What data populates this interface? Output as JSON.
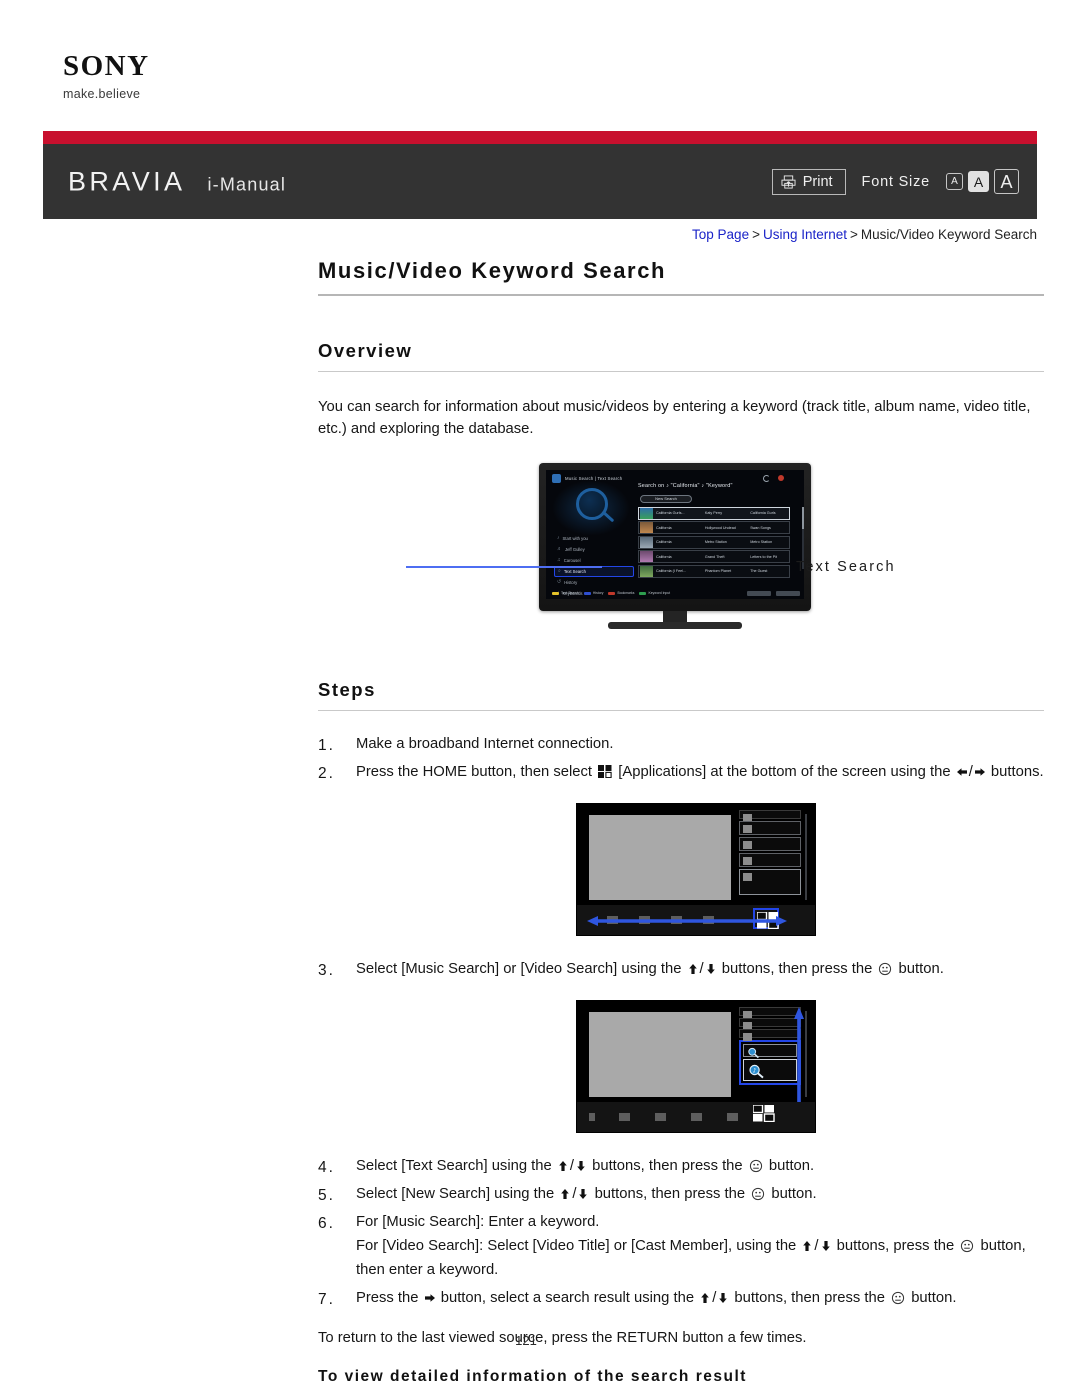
{
  "brand": {
    "logo_text": "SONY",
    "tagline": "make.believe"
  },
  "header": {
    "product": "BRAVIA",
    "manual_label": "i-Manual",
    "print_label": "Print",
    "print_icon": "printer-icon",
    "font_size_label": "Font Size",
    "font_size_options": [
      "A",
      "A",
      "A"
    ],
    "font_size_selected_index": 1,
    "bar_color": "#c8102e",
    "header_color": "#333333"
  },
  "breadcrumb": {
    "items": [
      {
        "label": "Top Page",
        "link": true
      },
      {
        "label": "Using Internet",
        "link": true
      },
      {
        "label": "Music/Video Keyword Search",
        "link": false
      }
    ],
    "separator": ">",
    "link_color": "#1a23c8"
  },
  "page": {
    "title": "Music/Video Keyword Search",
    "page_number": "121"
  },
  "overview": {
    "heading": "Overview",
    "body": "You can search for information about music/videos by entering a keyword (track title, album name, video title, etc.) and exploring the database.",
    "callout_label": "Text Search",
    "callout_color": "#4e6ef2"
  },
  "tv_screen": {
    "top_bar": "Music Search | Text Search",
    "search_line": "Search on ♪ \"California\" ♪ \"Keyword\"",
    "new_search_button": "New Search",
    "menu_items": [
      {
        "label": "Start with you",
        "glyph": "♪",
        "selected": false
      },
      {
        "label": "Jeff Gulley",
        "glyph": "♬",
        "selected": false
      },
      {
        "label": "Carousel",
        "glyph": "♫",
        "selected": false
      },
      {
        "label": "Text Search",
        "glyph": "⌕",
        "selected": true
      },
      {
        "label": "History",
        "glyph": "↺",
        "selected": false
      },
      {
        "label": "Keyboards",
        "glyph": "♪",
        "selected": false
      }
    ],
    "results": [
      {
        "title": "California Gurls...",
        "artist": "Katy Perry",
        "album": "California Gurls",
        "selected": true
      },
      {
        "title": "California",
        "artist": "Hollywood Undead",
        "album": "Swan Songs",
        "selected": false
      },
      {
        "title": "California",
        "artist": "Metro Station",
        "album": "Metro Station",
        "selected": false
      },
      {
        "title": "California",
        "artist": "Grand Theft",
        "album": "Letters to the Pit",
        "selected": false
      },
      {
        "title": "California (I Feel...",
        "artist": "Phantom Planet",
        "album": "The Guest",
        "selected": false
      }
    ],
    "function_buttons": [
      {
        "label": "Text Search",
        "color": "#e3c12a"
      },
      {
        "label": "History",
        "color": "#2f4fd0"
      },
      {
        "label": "Bookmarks",
        "color": "#c0392b"
      },
      {
        "label": "Keyword Input",
        "color": "#2e9e4f"
      }
    ]
  },
  "steps_section": {
    "heading": "Steps",
    "items": [
      {
        "number": "1.",
        "parts": [
          {
            "t": "text",
            "v": "Make a broadband Internet connection."
          }
        ]
      },
      {
        "number": "2.",
        "parts": [
          {
            "t": "text",
            "v": "Press the HOME button, then select "
          },
          {
            "t": "icon",
            "v": "apps-icon"
          },
          {
            "t": "text",
            "v": " [Applications] at the bottom of the screen using the "
          },
          {
            "t": "icon",
            "v": "arrow-left-icon"
          },
          {
            "t": "text",
            "v": "/"
          },
          {
            "t": "icon",
            "v": "arrow-right-icon"
          },
          {
            "t": "text",
            "v": " buttons."
          }
        ]
      },
      {
        "number": "3.",
        "parts": [
          {
            "t": "text",
            "v": "Select [Music Search] or [Video Search] using the "
          },
          {
            "t": "icon",
            "v": "arrow-up-icon"
          },
          {
            "t": "text",
            "v": "/"
          },
          {
            "t": "icon",
            "v": "arrow-down-icon"
          },
          {
            "t": "text",
            "v": " buttons, then press the "
          },
          {
            "t": "icon",
            "v": "enter-icon"
          },
          {
            "t": "text",
            "v": " button."
          }
        ]
      },
      {
        "number": "4.",
        "parts": [
          {
            "t": "text",
            "v": "Select [Text Search] using the "
          },
          {
            "t": "icon",
            "v": "arrow-up-icon"
          },
          {
            "t": "text",
            "v": "/"
          },
          {
            "t": "icon",
            "v": "arrow-down-icon"
          },
          {
            "t": "text",
            "v": " buttons, then press the "
          },
          {
            "t": "icon",
            "v": "enter-icon"
          },
          {
            "t": "text",
            "v": " button."
          }
        ]
      },
      {
        "number": "5.",
        "parts": [
          {
            "t": "text",
            "v": "Select [New Search] using the "
          },
          {
            "t": "icon",
            "v": "arrow-up-icon"
          },
          {
            "t": "text",
            "v": "/"
          },
          {
            "t": "icon",
            "v": "arrow-down-icon"
          },
          {
            "t": "text",
            "v": " buttons, then press the "
          },
          {
            "t": "icon",
            "v": "enter-icon"
          },
          {
            "t": "text",
            "v": " button."
          }
        ]
      },
      {
        "number": "6.",
        "parts": [
          {
            "t": "text",
            "v": "For [Music Search]: Enter a keyword."
          },
          {
            "t": "br"
          },
          {
            "t": "text",
            "v": "For [Video Search]: Select [Video Title] or [Cast Member], using the "
          },
          {
            "t": "icon",
            "v": "arrow-up-icon"
          },
          {
            "t": "text",
            "v": "/"
          },
          {
            "t": "icon",
            "v": "arrow-down-icon"
          },
          {
            "t": "text",
            "v": " buttons, press the "
          },
          {
            "t": "icon",
            "v": "enter-icon"
          },
          {
            "t": "text",
            "v": " button, then enter a keyword."
          }
        ]
      },
      {
        "number": "7.",
        "parts": [
          {
            "t": "text",
            "v": "Press the "
          },
          {
            "t": "icon",
            "v": "arrow-right-icon"
          },
          {
            "t": "text",
            "v": " button, select a search result using the "
          },
          {
            "t": "icon",
            "v": "arrow-up-icon"
          },
          {
            "t": "text",
            "v": "/"
          },
          {
            "t": "icon",
            "v": "arrow-down-icon"
          },
          {
            "t": "text",
            "v": " buttons, then press the "
          },
          {
            "t": "icon",
            "v": "enter-icon"
          },
          {
            "t": "text",
            "v": " button."
          }
        ]
      }
    ],
    "closing_note": "To return to the last viewed source, press the RETURN button a few times.",
    "subsection_heading": "To view detailed information of the search result"
  },
  "diagrams": [
    {
      "name": "home-screen-applications",
      "highlight_color": "#2346e8",
      "arrow_direction": "horizontal",
      "highlighted_element": "apps-icon"
    },
    {
      "name": "applications-search-items",
      "highlight_color": "#2346e8",
      "arrow_direction": "vertical",
      "highlighted_element": "music-search-video-search"
    }
  ]
}
